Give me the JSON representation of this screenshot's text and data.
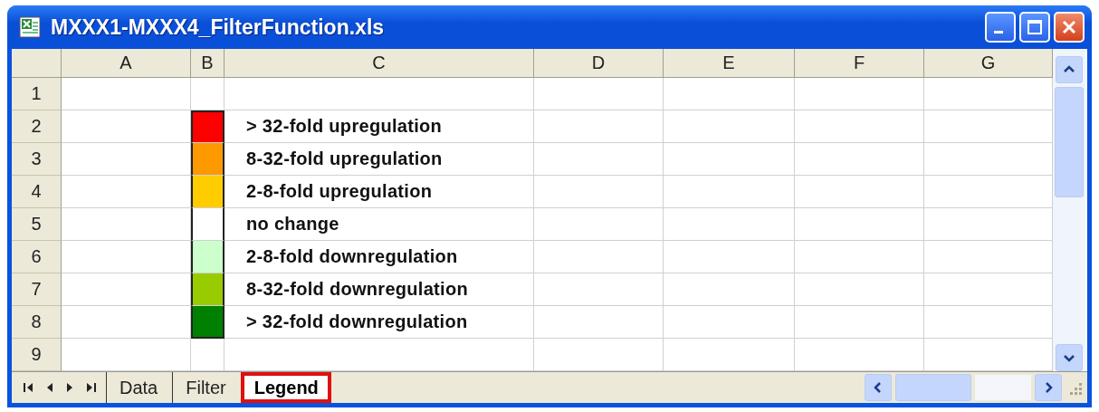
{
  "window": {
    "title": "MXXX1-MXXX4_FilterFunction.xls"
  },
  "columns": [
    "A",
    "B",
    "C",
    "D",
    "E",
    "F",
    "G"
  ],
  "rows": [
    {
      "number": "1"
    },
    {
      "number": "2",
      "color": "#ff0000",
      "label": "> 32-fold upregulation"
    },
    {
      "number": "3",
      "color": "#ff9900",
      "label": "8-32-fold upregulation"
    },
    {
      "number": "4",
      "color": "#ffcc00",
      "label": "2-8-fold upregulation"
    },
    {
      "number": "5",
      "color": "#ffffff",
      "label": "no change"
    },
    {
      "number": "6",
      "color": "#ccffcc",
      "label": "2-8-fold downregulation"
    },
    {
      "number": "7",
      "color": "#99cc00",
      "label": "8-32-fold downregulation"
    },
    {
      "number": "8",
      "color": "#008000",
      "label": "> 32-fold downregulation"
    },
    {
      "number": "9"
    }
  ],
  "sheet_tabs": [
    {
      "label": "Data",
      "selected": false,
      "highlighted": false
    },
    {
      "label": "Filter",
      "selected": false,
      "highlighted": false
    },
    {
      "label": "Legend",
      "selected": true,
      "highlighted": true
    }
  ]
}
